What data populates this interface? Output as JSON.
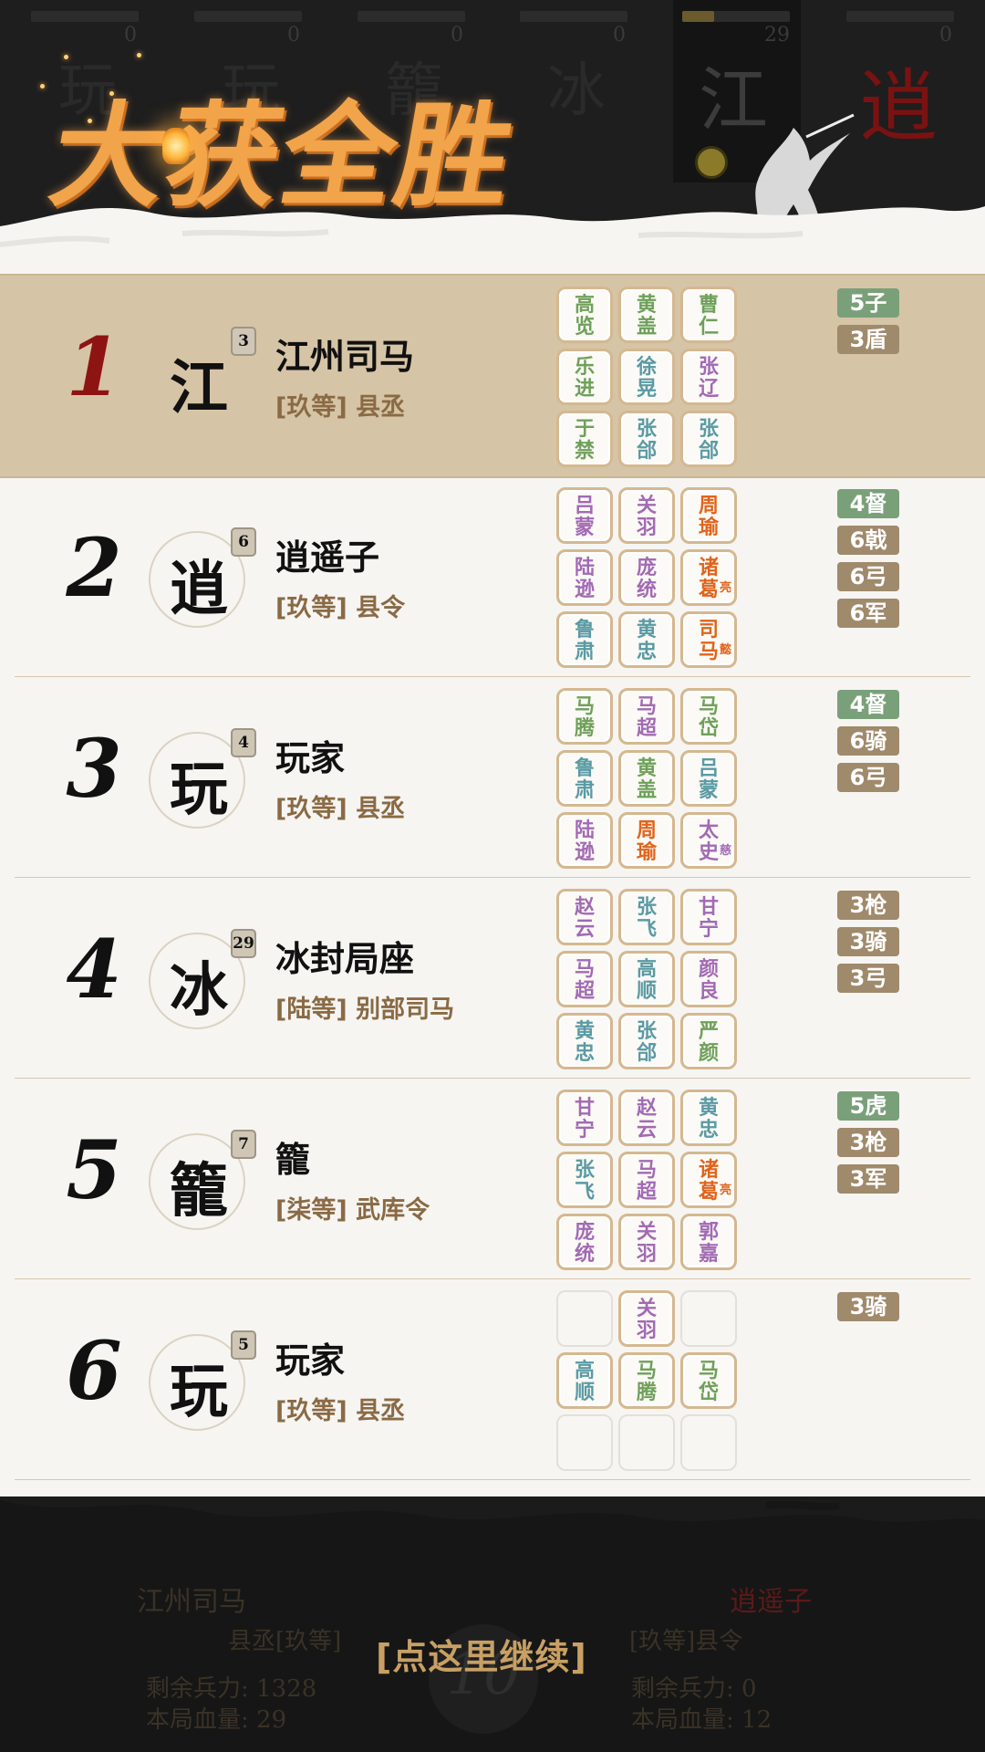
{
  "top": {
    "slots": [
      {
        "num": "0",
        "ghost": "玩",
        "fill": 0
      },
      {
        "num": "0",
        "ghost": "玩",
        "fill": 0
      },
      {
        "num": "0",
        "ghost": "籠",
        "fill": 0
      },
      {
        "num": "0",
        "ghost": "冰",
        "fill": 0
      },
      {
        "num": "29",
        "ghost": "江",
        "fill": 0.3
      },
      {
        "num": "0",
        "ghost": "逍",
        "fill": 0
      }
    ],
    "banner": "大获全胜"
  },
  "rows": [
    {
      "rank": "1",
      "avatar": "江",
      "level": "3",
      "name": "江州司马",
      "title": "[玖等] 县丞",
      "heroes": [
        {
          "n": "高览",
          "c": "green"
        },
        {
          "n": "黄盖",
          "c": "green"
        },
        {
          "n": "曹仁",
          "c": "green"
        },
        {
          "n": "乐进",
          "c": "green"
        },
        {
          "n": "徐晃",
          "c": "teal"
        },
        {
          "n": "张辽",
          "c": "purple"
        },
        {
          "n": "于禁",
          "c": "green"
        },
        {
          "n": "张郃",
          "c": "teal"
        },
        {
          "n": "张郃",
          "c": "teal"
        }
      ],
      "tags": [
        {
          "t": "5子",
          "c": "green"
        },
        {
          "t": "3盾",
          "c": "brown"
        }
      ]
    },
    {
      "rank": "2",
      "avatar": "逍",
      "level": "6",
      "name": "逍遥子",
      "title": "[玖等] 县令",
      "heroes": [
        {
          "n": "吕蒙",
          "c": "purple"
        },
        {
          "n": "关羽",
          "c": "purple"
        },
        {
          "n": "周瑜",
          "c": "orange"
        },
        {
          "n": "陆逊",
          "c": "purple"
        },
        {
          "n": "庞统",
          "c": "purple"
        },
        {
          "n": "诸葛",
          "c": "orange",
          "sub": "亮"
        },
        {
          "n": "鲁肃",
          "c": "teal"
        },
        {
          "n": "黄忠",
          "c": "teal"
        },
        {
          "n": "司马",
          "c": "orange",
          "sub": "懿"
        }
      ],
      "tags": [
        {
          "t": "4督",
          "c": "green"
        },
        {
          "t": "6戟",
          "c": "brown"
        },
        {
          "t": "6弓",
          "c": "brown"
        },
        {
          "t": "6军",
          "c": "brown"
        }
      ]
    },
    {
      "rank": "3",
      "avatar": "玩",
      "level": "4",
      "name": "玩家",
      "title": "[玖等] 县丞",
      "heroes": [
        {
          "n": "马腾",
          "c": "green"
        },
        {
          "n": "马超",
          "c": "purple"
        },
        {
          "n": "马岱",
          "c": "green"
        },
        {
          "n": "鲁肃",
          "c": "teal"
        },
        {
          "n": "黄盖",
          "c": "green"
        },
        {
          "n": "吕蒙",
          "c": "teal"
        },
        {
          "n": "陆逊",
          "c": "purple"
        },
        {
          "n": "周瑜",
          "c": "orange"
        },
        {
          "n": "太史",
          "c": "purple",
          "sub": "慈"
        }
      ],
      "tags": [
        {
          "t": "4督",
          "c": "green"
        },
        {
          "t": "6骑",
          "c": "brown"
        },
        {
          "t": "6弓",
          "c": "brown"
        }
      ]
    },
    {
      "rank": "4",
      "avatar": "冰",
      "level": "29",
      "name": "冰封局座",
      "title": "[陆等] 别部司马",
      "heroes": [
        {
          "n": "赵云",
          "c": "purple"
        },
        {
          "n": "张飞",
          "c": "teal"
        },
        {
          "n": "甘宁",
          "c": "purple"
        },
        {
          "n": "马超",
          "c": "purple"
        },
        {
          "n": "高顺",
          "c": "teal"
        },
        {
          "n": "颜良",
          "c": "purple"
        },
        {
          "n": "黄忠",
          "c": "teal"
        },
        {
          "n": "张郃",
          "c": "teal"
        },
        {
          "n": "严颜",
          "c": "green"
        }
      ],
      "tags": [
        {
          "t": "3枪",
          "c": "brown"
        },
        {
          "t": "3骑",
          "c": "brown"
        },
        {
          "t": "3弓",
          "c": "brown"
        }
      ]
    },
    {
      "rank": "5",
      "avatar": "籠",
      "level": "7",
      "name": "籠",
      "title": "[柒等] 武库令",
      "heroes": [
        {
          "n": "甘宁",
          "c": "purple"
        },
        {
          "n": "赵云",
          "c": "purple"
        },
        {
          "n": "黄忠",
          "c": "teal"
        },
        {
          "n": "张飞",
          "c": "teal"
        },
        {
          "n": "马超",
          "c": "purple"
        },
        {
          "n": "诸葛",
          "c": "orange",
          "sub": "亮"
        },
        {
          "n": "庞统",
          "c": "purple"
        },
        {
          "n": "关羽",
          "c": "purple"
        },
        {
          "n": "郭嘉",
          "c": "purple"
        }
      ],
      "tags": [
        {
          "t": "5虎",
          "c": "green"
        },
        {
          "t": "3枪",
          "c": "brown"
        },
        {
          "t": "3军",
          "c": "brown"
        }
      ]
    },
    {
      "rank": "6",
      "avatar": "玩",
      "level": "5",
      "name": "玩家",
      "title": "[玖等] 县丞",
      "heroes": [
        {
          "n": "",
          "c": "empty"
        },
        {
          "n": "关羽",
          "c": "purple"
        },
        {
          "n": "",
          "c": "empty"
        },
        {
          "n": "高顺",
          "c": "teal"
        },
        {
          "n": "马腾",
          "c": "green"
        },
        {
          "n": "马岱",
          "c": "green"
        },
        {
          "n": "",
          "c": "empty"
        },
        {
          "n": "",
          "c": "empty"
        },
        {
          "n": "",
          "c": "empty"
        }
      ],
      "tags": [
        {
          "t": "3骑",
          "c": "brown"
        }
      ]
    }
  ],
  "bottom": {
    "left_name": "江州司马",
    "left_rank": "县丞[玖等]",
    "left_troops": "剩余兵力:  1328",
    "left_hp": "本局血量:  29",
    "right_name": "逍遥子",
    "right_rank": "[玖等]县令",
    "right_troops": "剩余兵力:  0",
    "right_hp": "本局血量:  12",
    "clock": "10",
    "continue": "[点这里继续]"
  }
}
